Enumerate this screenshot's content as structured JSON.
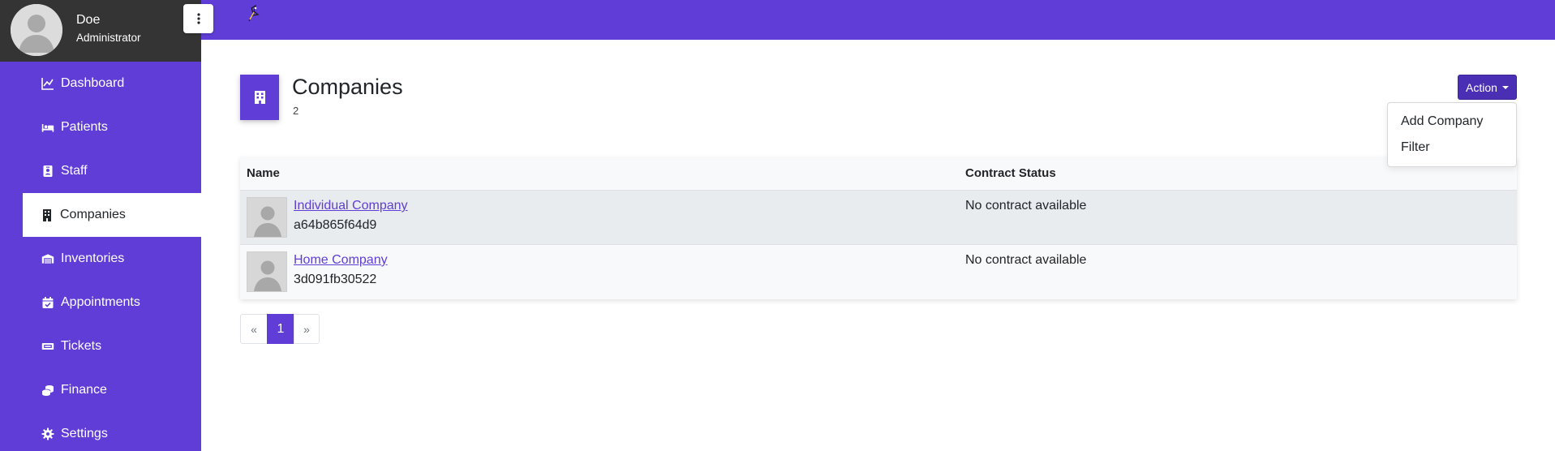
{
  "user": {
    "name": "Doe",
    "role": "Administrator"
  },
  "sidebar": {
    "items": [
      {
        "label": "Dashboard",
        "icon": "chart-line-icon"
      },
      {
        "label": "Patients",
        "icon": "bed-icon"
      },
      {
        "label": "Staff",
        "icon": "id-badge-icon"
      },
      {
        "label": "Companies",
        "icon": "building-icon",
        "active": true
      },
      {
        "label": "Inventories",
        "icon": "warehouse-icon"
      },
      {
        "label": "Appointments",
        "icon": "calendar-check-icon"
      },
      {
        "label": "Tickets",
        "icon": "ticket-icon"
      },
      {
        "label": "Finance",
        "icon": "coins-icon"
      },
      {
        "label": "Settings",
        "icon": "gear-icon"
      }
    ]
  },
  "page": {
    "title": "Companies",
    "count": "2"
  },
  "action": {
    "label": "Action",
    "menu": [
      "Add Company",
      "Filter"
    ]
  },
  "table": {
    "columns": [
      "Name",
      "Contract Status"
    ],
    "rows": [
      {
        "name": "Individual Company",
        "id": "a64b865f64d9",
        "status": "No contract available"
      },
      {
        "name": "Home Company",
        "id": "3d091fb30522",
        "status": "No contract available"
      }
    ]
  },
  "pagination": {
    "prev": "«",
    "current": "1",
    "next": "»"
  },
  "colors": {
    "primary": "#5f3dd6",
    "profile_bg": "#343434",
    "action_btn": "#4a2fb4"
  }
}
